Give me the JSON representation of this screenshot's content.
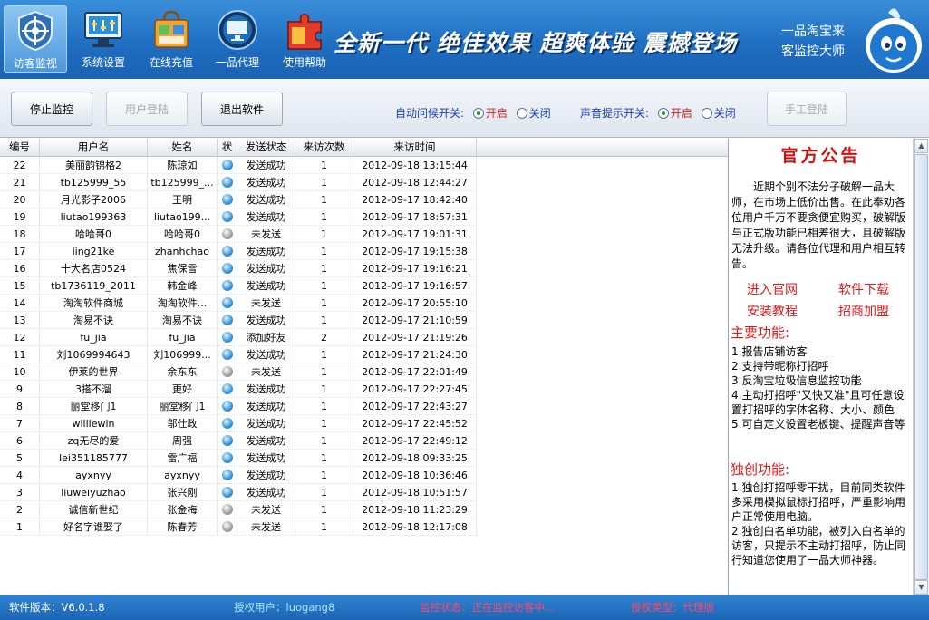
{
  "toolbar_top": {
    "buttons": [
      {
        "label": "访客监视",
        "icon": "target-icon",
        "active": true
      },
      {
        "label": "系统设置",
        "icon": "monitor-settings-icon",
        "active": false
      },
      {
        "label": "在线充值",
        "icon": "shopping-bag-icon",
        "active": false
      },
      {
        "label": "一品代理",
        "icon": "screen-circle-icon",
        "active": false
      },
      {
        "label": "使用帮助",
        "icon": "puzzle-help-icon",
        "active": false
      }
    ],
    "slogan": "全新一代 绝佳效果 超爽体验 震撼登场",
    "brand_line1": "一品淘宝来",
    "brand_line2": "客监控大师"
  },
  "actions": {
    "stop_monitor": "停止监控",
    "user_login": "用户登陆",
    "exit_app": "退出软件",
    "manual_login": "手工登陆"
  },
  "toggles": {
    "auto_greet": {
      "title": "自动问候开关:",
      "on": "开启",
      "off": "关闭",
      "selected": "on"
    },
    "sound_alert": {
      "title": "声音提示开关:",
      "on": "开启",
      "off": "关闭",
      "selected": "on"
    }
  },
  "table": {
    "headers": [
      "编号",
      "用户名",
      "姓名",
      "状",
      "发送状态",
      "来访次数",
      "来访时间"
    ],
    "rows": [
      {
        "id": "22",
        "username": "美丽韵锦格2",
        "name": "陈琼如",
        "status": "online",
        "send": "发送成功",
        "visits": "1",
        "time": "2012-09-18 13:15:44"
      },
      {
        "id": "21",
        "username": "tb125999_55",
        "name": "tb125999_...",
        "status": "online",
        "send": "发送成功",
        "visits": "1",
        "time": "2012-09-18 12:44:27"
      },
      {
        "id": "20",
        "username": "月光影子2006",
        "name": "王明",
        "status": "online",
        "send": "发送成功",
        "visits": "1",
        "time": "2012-09-17 18:42:40"
      },
      {
        "id": "19",
        "username": "liutao199363",
        "name": "liutao199...",
        "status": "online",
        "send": "发送成功",
        "visits": "1",
        "time": "2012-09-17 18:57:31"
      },
      {
        "id": "18",
        "username": "哈哈哥0",
        "name": "哈哈哥0",
        "status": "offline",
        "send": "未发送",
        "visits": "1",
        "time": "2012-09-17 19:01:31"
      },
      {
        "id": "17",
        "username": "ling21ke",
        "name": "zhanhchao",
        "status": "online",
        "send": "发送成功",
        "visits": "1",
        "time": "2012-09-17 19:15:38"
      },
      {
        "id": "16",
        "username": "十大名店0524",
        "name": "焦保雪",
        "status": "online",
        "send": "发送成功",
        "visits": "1",
        "time": "2012-09-17 19:16:21"
      },
      {
        "id": "15",
        "username": "tb1736119_2011",
        "name": "韩金峰",
        "status": "online",
        "send": "发送成功",
        "visits": "1",
        "time": "2012-09-17 19:16:57"
      },
      {
        "id": "14",
        "username": "淘淘软件商城",
        "name": "淘淘软件...",
        "status": "online",
        "send": "未发送",
        "visits": "1",
        "time": "2012-09-17 20:55:10"
      },
      {
        "id": "13",
        "username": "淘易不诀",
        "name": "淘易不诀",
        "status": "online",
        "send": "发送成功",
        "visits": "1",
        "time": "2012-09-17 21:10:59"
      },
      {
        "id": "12",
        "username": "fu_jia",
        "name": "fu_jia",
        "status": "online",
        "send": "添加好友",
        "visits": "2",
        "time": "2012-09-17 21:19:26"
      },
      {
        "id": "11",
        "username": "刘1069994643",
        "name": "刘106999...",
        "status": "online",
        "send": "发送成功",
        "visits": "1",
        "time": "2012-09-17 21:24:30"
      },
      {
        "id": "10",
        "username": "伊莱的世界",
        "name": "余东东",
        "status": "offline",
        "send": "未发送",
        "visits": "1",
        "time": "2012-09-17 22:01:49"
      },
      {
        "id": "9",
        "username": "3搭不溜",
        "name": "更好",
        "status": "online",
        "send": "发送成功",
        "visits": "1",
        "time": "2012-09-17 22:27:45"
      },
      {
        "id": "8",
        "username": "丽堂移门1",
        "name": "丽堂移门1",
        "status": "online",
        "send": "发送成功",
        "visits": "1",
        "time": "2012-09-17 22:43:27"
      },
      {
        "id": "7",
        "username": "williewin",
        "name": "邬仕政",
        "status": "online",
        "send": "发送成功",
        "visits": "1",
        "time": "2012-09-17 22:45:52"
      },
      {
        "id": "6",
        "username": "zq无尽的爱",
        "name": "周强",
        "status": "online",
        "send": "发送成功",
        "visits": "1",
        "time": "2012-09-17 22:49:12"
      },
      {
        "id": "5",
        "username": "lei351185777",
        "name": "雷广福",
        "status": "online",
        "send": "发送成功",
        "visits": "1",
        "time": "2012-09-18 09:33:25"
      },
      {
        "id": "4",
        "username": "ayxnyy",
        "name": "ayxnyy",
        "status": "online",
        "send": "发送成功",
        "visits": "1",
        "time": "2012-09-18 10:36:46"
      },
      {
        "id": "3",
        "username": "liuweiyuzhao",
        "name": "张兴刚",
        "status": "online",
        "send": "发送成功",
        "visits": "1",
        "time": "2012-09-18 10:51:57"
      },
      {
        "id": "2",
        "username": "诚信新世纪",
        "name": "张金梅",
        "status": "offline",
        "send": "未发送",
        "visits": "1",
        "time": "2012-09-18 11:23:29"
      },
      {
        "id": "1",
        "username": "好名字谁娶了",
        "name": "陈春芳",
        "status": "offline",
        "send": "未发送",
        "visits": "1",
        "time": "2012-09-18 12:17:08"
      }
    ]
  },
  "notice": {
    "title": "官方公告",
    "body": "近期个别不法分子破解一品大师，在市场上低价出售。在此奉劝各位用户千万不要贪便宜购买，破解版与正式版功能已相差很大，且破解版无法升级。请各位代理和用户相互转告。",
    "links": [
      "进入官网",
      "软件下载",
      "安装教程",
      "招商加盟"
    ],
    "main_title": "主要功能:",
    "main_items": [
      "1.报告店铺访客",
      "2.支持带昵称打招呼",
      "3.反淘宝垃圾信息监控功能",
      "4.主动打招呼\"又快又准\"且可任意设置打招呼的字体名称、大小、颜色",
      "5.可自定义设置老板键、提醒声音等"
    ],
    "unique_title": "独创功能:",
    "unique_items": [
      "1.独创打招呼零干扰，目前同类软件多采用模拟鼠标打招呼，严重影响用户正常使用电脑。",
      "2.独创白名单功能，被列入白名单的访客，只提示不主动打招呼，防止同行知道您使用了一品大师神器。"
    ]
  },
  "status_bar": {
    "version": "软件版本：V6.0.1.8",
    "user": "授权用户：luogang8",
    "monitor": "监控状态：正在监控访客中...",
    "license": "授权类型：代理版"
  },
  "colors": {
    "header_blue": "#1f6fc2",
    "accent_red": "#e01a1a",
    "status_bar_blue": "#1c64b6"
  }
}
